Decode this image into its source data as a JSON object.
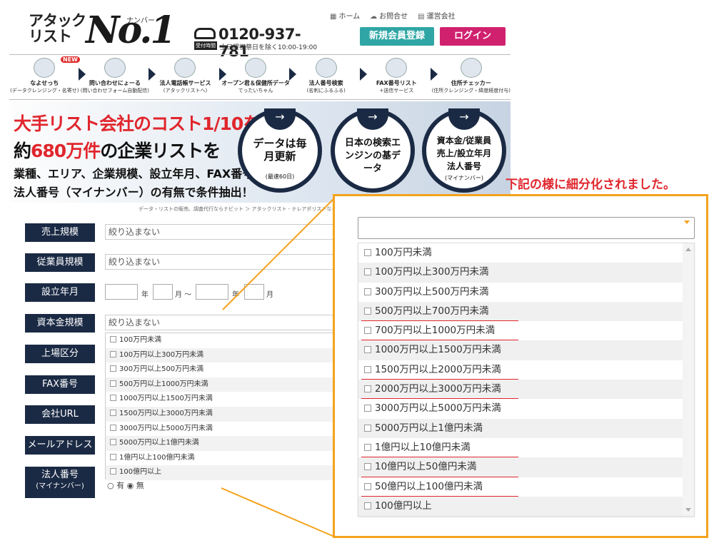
{
  "header": {
    "logo_line1": "アタック",
    "logo_line2": "リスト",
    "logo_no1": "No.1",
    "logo_reading": "ナンバー",
    "phone": "0120-937-781",
    "phone_badge": "受付時間",
    "phone_hours": "土日曜祝祭日を除く10:00-19:00",
    "links": [
      {
        "icon": "home-icon",
        "glyph": "▦",
        "label": "ホーム"
      },
      {
        "icon": "chat-icon",
        "glyph": "☁",
        "label": "お問合せ"
      },
      {
        "icon": "building-icon",
        "glyph": "▤",
        "label": "運営会社"
      }
    ],
    "register_label": "新規会員登録",
    "login_label": "ログイン",
    "register_color": "#2fa6a5",
    "login_color": "#d0216f"
  },
  "services": [
    {
      "t1": "なよせっち",
      "t2": "(データクレンジング・名寄せ)",
      "icon": "mascot-icon",
      "new": "NEW"
    },
    {
      "t1": "問い合わせにょーる",
      "t2": "(問い合わせフォーム自動配信)",
      "icon": "robot-icon"
    },
    {
      "t1": "法人電話帳サービス",
      "t2": "(アタックリストへ)",
      "icon": "telephone-icon"
    },
    {
      "t1": "オープン君＆保健所データ",
      "t2": "てったいちゃん",
      "icon": "character-icon"
    },
    {
      "t1": "法人番号検索",
      "t2": "(名刺にふるふる)",
      "icon": "corporate-number-icon"
    },
    {
      "t1": "FAX番号リスト",
      "t2": "+送信サービス",
      "icon": "fax-icon"
    },
    {
      "t1": "住所チェッカー",
      "t2": "(住所クレンジング・緯度経度付与)",
      "icon": "address-mascot-icon"
    }
  ],
  "banner": {
    "line1": "大手リスト会社のコスト1/10を実現",
    "line2_prefix": "約",
    "line2_red": "680万件",
    "line2_suffix": "の企業リストを",
    "line3": "業種、エリア、企業規模、設立年月、FAX番号",
    "line4": "法人番号（マイナンバー）の有無で条件抽出！",
    "circles": [
      {
        "big": "データは毎月更新",
        "small": "(最速60日)"
      },
      {
        "big": "日本の検索エンジンの基データ",
        "small": ""
      },
      {
        "big": "資本金/従業員売上/設立年月法人番号",
        "small": "(マイナンバー)"
      }
    ]
  },
  "breadcrumb": "データ・リストの販売、調査代行ならナビット ＞ アタックリスト - テレアポリストならア",
  "form": {
    "labels": [
      "売上規模",
      "従業員規模",
      "設立年月",
      "資本金規模",
      "上場区分",
      "FAX番号",
      "会社URL",
      "メールアドレス",
      "法人番号"
    ],
    "corporate_sub": "(マイナンバー)",
    "placeholder": "絞り込まない",
    "date_units": [
      "年",
      "月 ～",
      "年",
      "月"
    ],
    "capital_options": [
      "100万円未満",
      "100万円以上300万円未満",
      "300万円以上500万円未満",
      "500万円以上1000万円未満",
      "1000万円以上1500万円未満",
      "1500万円以上3000万円未満",
      "3000万円以上5000万円未満",
      "5000万円以上1億円未満",
      "1億円以上100億円未満",
      "100億円以上"
    ],
    "radio_yes": "有",
    "radio_no": "無"
  },
  "callout": {
    "note": "下記の様に細分化されました。",
    "border_color": "#f4a21c",
    "options": [
      "100万円未満",
      "100万円以上300万円未満",
      "300万円以上500万円未満",
      "500万円以上700万円未満",
      "700万円以上1000万円未満",
      "1000万円以上1500万円未満",
      "1500万円以上2000万円未満",
      "2000万円以上3000万円未満",
      "3000万円以上5000万円未満",
      "5000万円以上1億円未満",
      "1億円以上10億円未満",
      "10億円以上50億円未満",
      "50億円以上100億円未満",
      "100億円以上"
    ],
    "underlined": [
      3,
      4,
      6,
      7,
      10,
      11,
      12
    ]
  }
}
